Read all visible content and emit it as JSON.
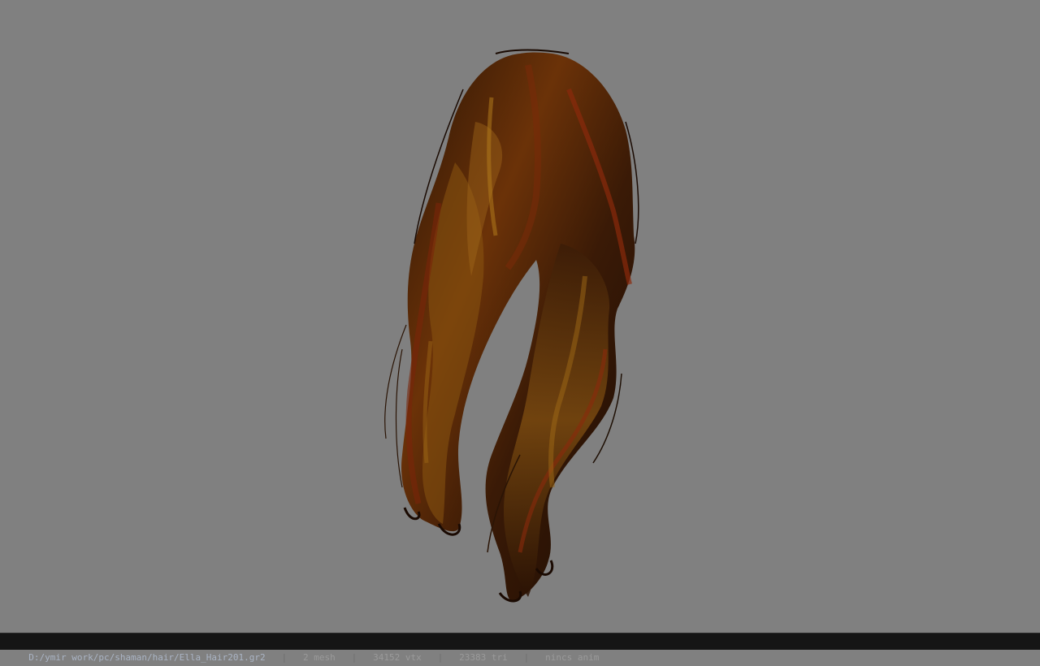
{
  "viewer": {
    "background_color": "#808080",
    "model_label": "hair-model",
    "model_colors": {
      "dark": "#1e0f04",
      "mid": "#5a2608",
      "red": "#8a2a0c",
      "gold": "#8a5a12"
    }
  },
  "statusbar": {
    "file_path": "D:/ymir work/pc/shaman/hair/Ella_Hair201.gr2",
    "separator": "|",
    "mesh_count": "2 mesh",
    "vertex_count": "34152 vtx",
    "triangle_count": "23383 tri",
    "animation": "nincs anim"
  }
}
